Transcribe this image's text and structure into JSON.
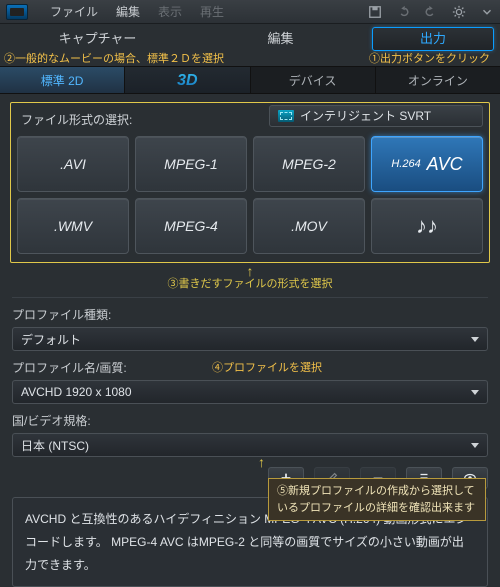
{
  "menubar": {
    "items": [
      "ファイル",
      "編集",
      "表示",
      "再生"
    ]
  },
  "maintabs": {
    "capture": "キャプチャー",
    "edit": "編集",
    "output": "出力"
  },
  "annotations": {
    "a2": "②一般的なムービーの場合、標準２Ｄを選択",
    "a1": "①出力ボタンをクリック",
    "a3": "③書きだすファイルの形式を選択",
    "a4": "④プロファイルを選択",
    "a5": "⑤新規プロファイルの作成から選択しているプロファイルの詳細を確認出来ます"
  },
  "sectabs": {
    "std2d": "標準 2D",
    "threeD": "3D",
    "device": "デバイス",
    "online": "オンライン"
  },
  "format": {
    "label": "ファイル形式の選択:",
    "svrt": "インテリジェント SVRT",
    "items": [
      ".AVI",
      "MPEG-1",
      "MPEG-2",
      "H.264 AVC",
      ".WMV",
      "MPEG-4",
      ".MOV",
      "♪♪"
    ],
    "h264_pre": "H.264",
    "h264_main": "AVC"
  },
  "profileType": {
    "label": "プロファイル種類:",
    "value": "デフォルト"
  },
  "profileName": {
    "label": "プロファイル名/画質:",
    "value": "AVCHD 1920 x 1080"
  },
  "country": {
    "label": "国/ビデオ規格:",
    "value": "日本 (NTSC)"
  },
  "description": "AVCHD と互換性のあるハイデフィニション MPEG-4 AVC (H.264) 動画形式にエンコードします。 MPEG-4 AVC はMPEG-2 と同等の画質でサイズの小さい動画が出力できます。"
}
